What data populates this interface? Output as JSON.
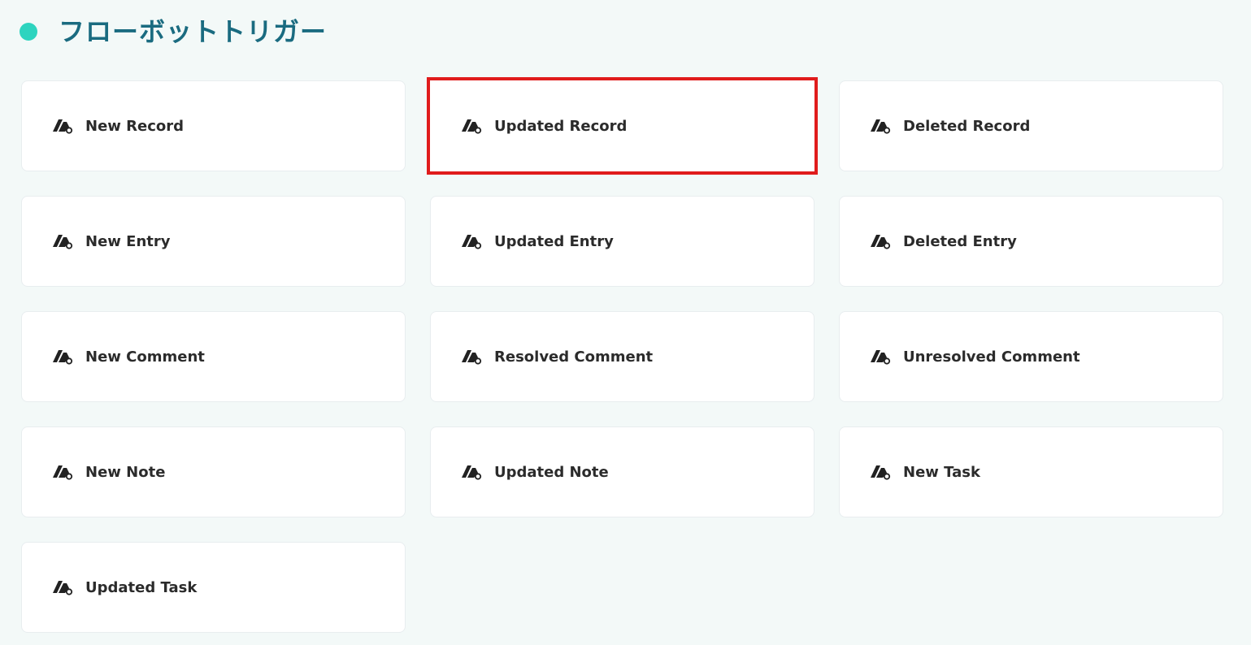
{
  "header": {
    "title": "フローボットトリガー",
    "accent_color": "#2dd4bf",
    "title_color": "#1a6b80"
  },
  "highlight_color": "#e01c1c",
  "triggers": [
    {
      "label": "New Record",
      "icon": "attio-logo-icon",
      "highlighted": false
    },
    {
      "label": "Updated Record",
      "icon": "attio-logo-icon",
      "highlighted": true
    },
    {
      "label": "Deleted Record",
      "icon": "attio-logo-icon",
      "highlighted": false
    },
    {
      "label": "New Entry",
      "icon": "attio-logo-icon",
      "highlighted": false
    },
    {
      "label": "Updated Entry",
      "icon": "attio-logo-icon",
      "highlighted": false
    },
    {
      "label": "Deleted Entry",
      "icon": "attio-logo-icon",
      "highlighted": false
    },
    {
      "label": "New Comment",
      "icon": "attio-logo-icon",
      "highlighted": false
    },
    {
      "label": "Resolved Comment",
      "icon": "attio-logo-icon",
      "highlighted": false
    },
    {
      "label": "Unresolved Comment",
      "icon": "attio-logo-icon",
      "highlighted": false
    },
    {
      "label": "New Note",
      "icon": "attio-logo-icon",
      "highlighted": false
    },
    {
      "label": "Updated Note",
      "icon": "attio-logo-icon",
      "highlighted": false
    },
    {
      "label": "New Task",
      "icon": "attio-logo-icon",
      "highlighted": false
    },
    {
      "label": "Updated Task",
      "icon": "attio-logo-icon",
      "highlighted": false
    }
  ]
}
